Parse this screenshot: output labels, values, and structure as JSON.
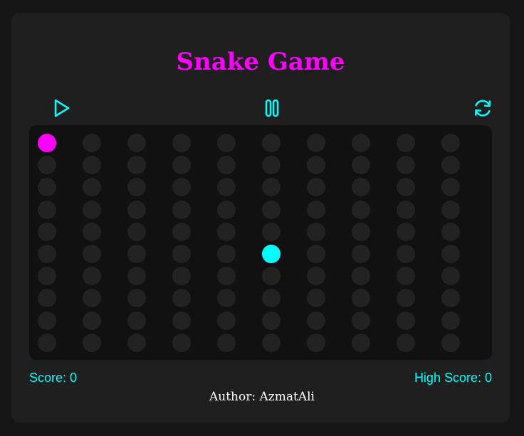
{
  "title": "Snake Game",
  "controls": {
    "play_icon": "play-icon",
    "pause_icon": "pause-icon",
    "restart_icon": "restart-icon"
  },
  "board": {
    "columns": 10,
    "rows": 10,
    "snake": [
      {
        "col": 5,
        "row": 5
      }
    ],
    "food": {
      "col": 0,
      "row": 0
    }
  },
  "score": {
    "label": "Score: 0",
    "value": 0
  },
  "high_score": {
    "label": "High Score: 0",
    "value": 0
  },
  "author": "Author: AzmatAli",
  "colors": {
    "background": "#161616",
    "panel": "#1f1f1f",
    "board": "#111111",
    "cell": "#222222",
    "snake": "#00ffff",
    "food": "#ff00ff",
    "title": "#ff00ff",
    "accent": "#00ffff",
    "author": "#ffffff"
  }
}
